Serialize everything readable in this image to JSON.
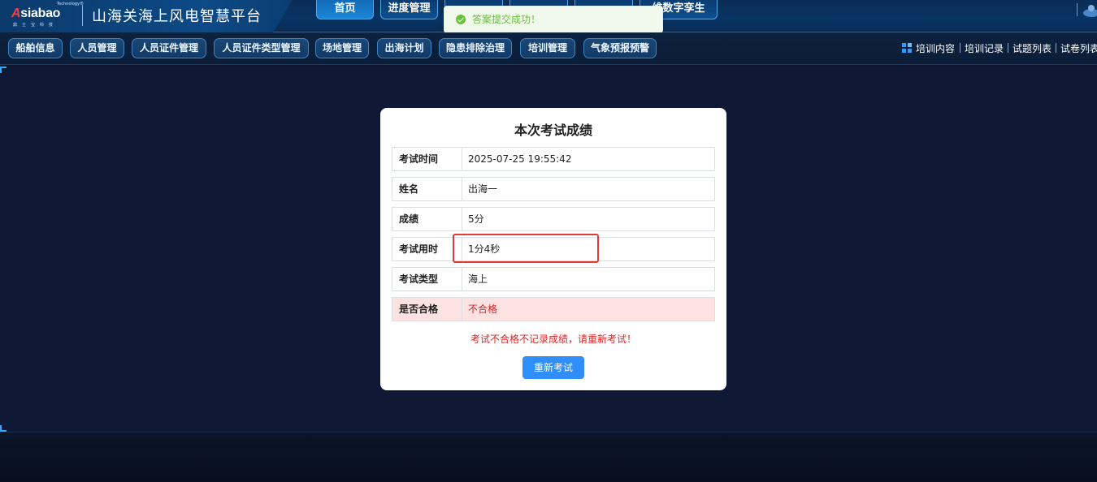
{
  "header": {
    "logo_text": "Asiabao",
    "logo_tm": "Technology®",
    "logo_sub": "鼎士宝科技",
    "title": "山海关海上风电智慧平台",
    "nav": [
      "首页",
      "进度管理",
      "",
      "",
      "",
      "维数字孪生"
    ],
    "active_nav": "首页"
  },
  "toast": {
    "message": "答案提交成功！",
    "type": "success",
    "color": "#67c23a"
  },
  "subnav": {
    "buttons": [
      "船舶信息",
      "人员管理",
      "人员证件管理",
      "人员证件类型管理",
      "场地管理",
      "出海计划",
      "隐患排除治理",
      "培训管理",
      "气象预报预警"
    ],
    "links": [
      "培训内容",
      "培训记录",
      "试题列表",
      "试卷列表"
    ]
  },
  "result": {
    "title": "本次考试成绩",
    "rows": [
      {
        "label": "考试时间",
        "value": "2025-07-25 19:55:42"
      },
      {
        "label": "姓名",
        "value": "出海一"
      },
      {
        "label": "成绩",
        "value": "5分"
      },
      {
        "label": "考试用时",
        "value": "1分4秒"
      },
      {
        "label": "考试类型",
        "value": "海上"
      },
      {
        "label": "是否合格",
        "value": "不合格"
      }
    ],
    "note": "考试不合格不记录成绩，请重新考试！",
    "retry_label": "重新考试"
  },
  "colors": {
    "accent": "#2f8ef8",
    "fail_bg": "#fde2e2",
    "fail_text": "#e02424",
    "highlight": "#e53935"
  }
}
